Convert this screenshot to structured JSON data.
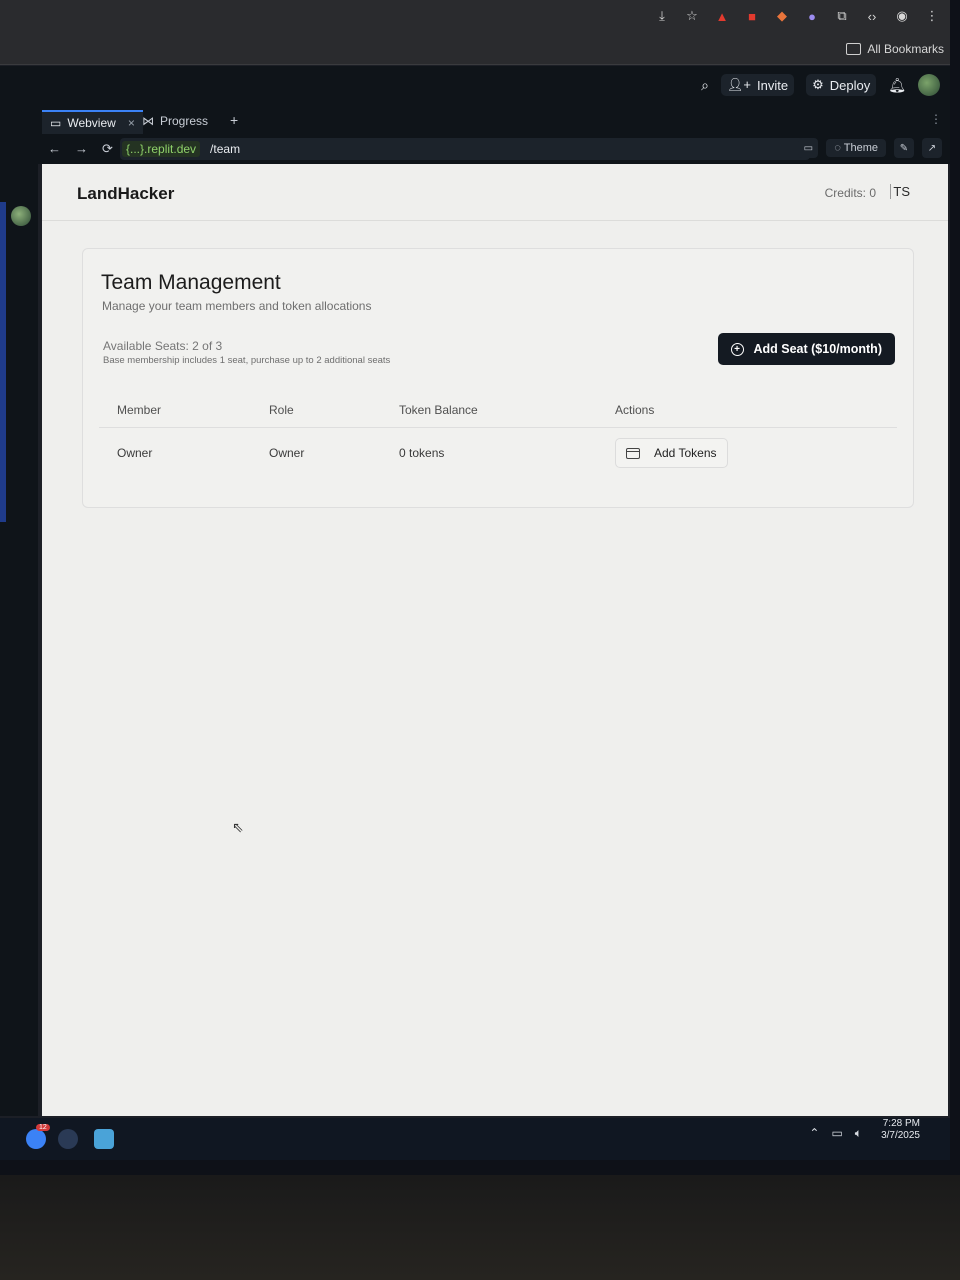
{
  "browser": {
    "bookmarks_label": "All Bookmarks"
  },
  "replit": {
    "invite_label": "Invite",
    "deploy_label": "Deploy",
    "tabs": [
      {
        "label": "Webview"
      },
      {
        "label": "Progress"
      }
    ],
    "url": {
      "host": "{...}.replit.dev",
      "path": "/team"
    },
    "theme_label": "Theme"
  },
  "app": {
    "brand": "LandHacker",
    "credits": "Credits: 0",
    "user_initials": "TS",
    "card": {
      "title": "Team Management",
      "subtitle": "Manage your team members and token allocations",
      "seats": "Available Seats: 2 of 3",
      "seats_note": "Base membership includes 1 seat, purchase up to 2 additional seats",
      "add_seat_label": "Add Seat ($10/month)"
    },
    "table": {
      "headers": [
        "Member",
        "Role",
        "Token Balance",
        "Actions"
      ],
      "rows": [
        {
          "member": "Owner",
          "role": "Owner",
          "tokens": "0 tokens",
          "action": "Add Tokens"
        }
      ]
    }
  },
  "taskbar": {
    "time": "7:28 PM",
    "date": "3/7/2025",
    "badge": "12"
  },
  "colors": {
    "accent": "#3b82f6",
    "primary_button": "#141a22",
    "page_bg": "#efefed"
  }
}
